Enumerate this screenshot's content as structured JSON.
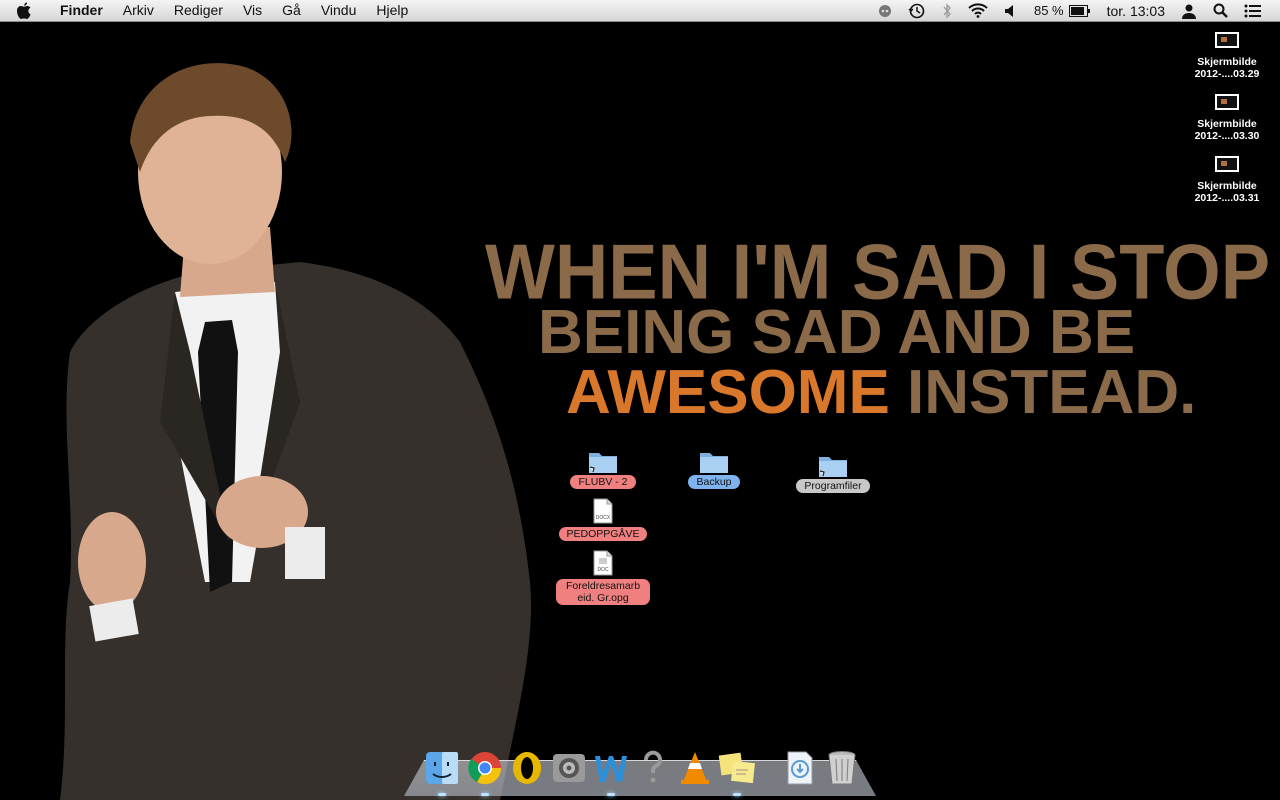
{
  "menubar": {
    "app_name": "Finder",
    "menus": [
      "Arkiv",
      "Rediger",
      "Vis",
      "Gå",
      "Vindu",
      "Hjelp"
    ],
    "battery": "85 %",
    "clock": "tor. 13:03",
    "status_icons": [
      "dropbox-icon",
      "time-machine-icon",
      "bluetooth-icon",
      "wifi-icon",
      "volume-icon",
      "battery-icon",
      "user-icon",
      "spotlight-icon",
      "notification-list-icon"
    ]
  },
  "wallpaper": {
    "line1": "WHEN I'M SAD I STOP",
    "line2": "BEING SAD AND BE",
    "line3_highlight": "AWESOME",
    "line3_rest": " INSTEAD.",
    "colors": {
      "main": "#8a6a48",
      "highlight": "#d9782a"
    }
  },
  "desktop": {
    "screenshots": [
      {
        "name": "Skjermbilde",
        "sub": "2012-....03.29"
      },
      {
        "name": "Skjermbilde",
        "sub": "2012-....03.30"
      },
      {
        "name": "Skjermbilde",
        "sub": "2012-....03.31"
      }
    ],
    "items": [
      {
        "label": "FLUBV - 2",
        "type": "folder-alias",
        "tag": "#f08080"
      },
      {
        "label": "Backup",
        "type": "folder",
        "tag": "#7fb3f0"
      },
      {
        "label": "Programfiler",
        "type": "folder-alias",
        "tag": "#c8c8c8"
      },
      {
        "label": "PEDOPPGÅVE",
        "type": "docx",
        "tag": "#f08080",
        "badge": "DOCX"
      },
      {
        "label": "Foreldresamarb eid. Gr.opg",
        "type": "doc",
        "tag": "#f08080",
        "badge": "DOC"
      }
    ]
  },
  "dock": {
    "items": [
      "finder-icon",
      "chrome-icon",
      "opera-icon",
      "system-preferences-icon",
      "word-icon",
      "help-icon",
      "vlc-icon",
      "stickies-icon",
      "downloads-stack-icon",
      "trash-icon"
    ]
  }
}
